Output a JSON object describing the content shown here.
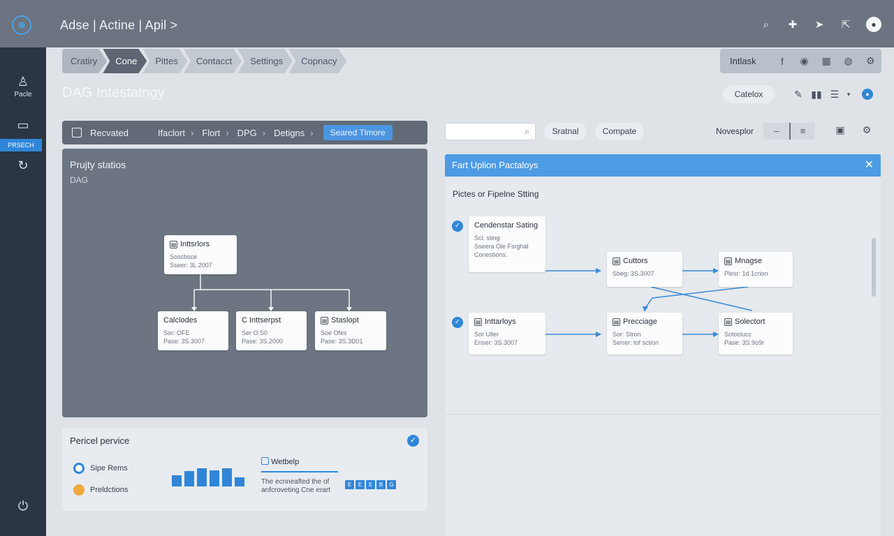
{
  "topbar": {
    "breadcrumb": "Adse | Actine | Apil >",
    "icons": [
      "search-icon",
      "puzzle-icon",
      "share-icon",
      "export-icon",
      "user-icon"
    ]
  },
  "sidebar": {
    "items": [
      {
        "icon": "user-icon",
        "label": "Pacle"
      },
      {
        "icon": "card-icon",
        "label": ""
      },
      {
        "icon": "refresh-icon",
        "label": ""
      },
      {
        "icon": "power-icon",
        "label": ""
      }
    ],
    "active_label": "PRSECH"
  },
  "tabs": [
    "Cratiry",
    "Cone",
    "Pittes",
    "Contacct",
    "Settings",
    "Copnacy"
  ],
  "rightbar": {
    "label": "Intlask"
  },
  "page": {
    "title": "DAG Intestatngy",
    "button": "Catelox"
  },
  "left_header": {
    "items": [
      "Recvated",
      "Ifaclort",
      "Flort",
      "DPG",
      "Detigns"
    ],
    "active": "Seared Tlmore"
  },
  "dag": {
    "title": "Prujty statios",
    "subtitle": "DAG",
    "nodes": [
      {
        "title": "Inttsrlors",
        "lines": [
          "Soscbsce",
          "Sseer: 3L 2007"
        ]
      },
      {
        "title": "Calclodes",
        "lines": [
          "Sor: OFE",
          "Pase: 3S.3007"
        ]
      },
      {
        "title": "C Inttserpst",
        "lines": [
          "Ser O:S0",
          "Pase: 3S.2000"
        ]
      },
      {
        "title": "Staslopt",
        "lines": [
          "Soe Ofes",
          "Pase: 3S.3D01"
        ]
      }
    ]
  },
  "perf": {
    "title": "Pericel pervice",
    "legend": [
      {
        "label": "Sipe Rems",
        "color": "#2f86d8"
      },
      {
        "label": "Preldctions",
        "color": "#f0a73c"
      }
    ],
    "bars": [
      0.45,
      0.6,
      0.72,
      0.65,
      0.72,
      0.35
    ],
    "webhelp_title": "Wetbelp",
    "webhelp_text": "The ecnneafted the of anfcroveting Cne erart",
    "grid_marks": [
      "E",
      "E",
      "E",
      "B",
      "G"
    ]
  },
  "right": {
    "search_placeholder": "",
    "pill1": "Sratnal",
    "pill2": "Compate",
    "nav_label": "Novesplor",
    "seg": [
      "–",
      "≡"
    ]
  },
  "flow": {
    "header": "Fart Uplion Pactaloys",
    "subtitle": "Pictes or Fipelne Stting",
    "nodes": [
      {
        "title": "Cendenstar Sating",
        "lines": [
          "Scl. sting",
          "Sseera Ole Fsrghal",
          "Conestions."
        ]
      },
      {
        "title": "Cuttors",
        "lines": [
          "Sbeg: 3S.3007"
        ]
      },
      {
        "title": "Mnagse",
        "lines": [
          "Plesr: 1d 1crion"
        ]
      },
      {
        "title": "Inttarloys",
        "lines": [
          "Sor Uller",
          "Eriser: 3S.3007"
        ]
      },
      {
        "title": "Precciage",
        "lines": [
          "Sor: Stron",
          "Serrer: tof sction"
        ]
      },
      {
        "title": "Solectort",
        "lines": [
          "Sotoclucc",
          "Pase: 3S.9o9r"
        ]
      }
    ]
  }
}
